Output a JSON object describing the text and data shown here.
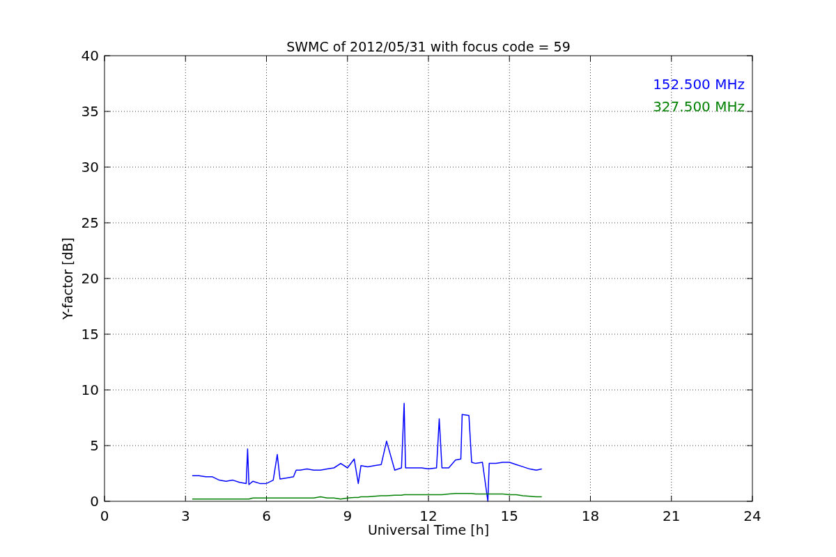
{
  "figure": {
    "chart_data": {
      "type": "line",
      "title": "SWMC of 2012/05/31 with focus code = 59",
      "xlabel": "Universal Time [h]",
      "ylabel": "Y-factor [dB]",
      "xlim": [
        0,
        24
      ],
      "ylim": [
        0,
        40
      ],
      "xticks": [
        0,
        3,
        6,
        9,
        12,
        15,
        18,
        21,
        24
      ],
      "yticks": [
        0,
        5,
        10,
        15,
        20,
        25,
        30,
        35,
        40
      ],
      "grid": true,
      "x": [
        3.25,
        3.5,
        3.75,
        4.0,
        4.25,
        4.5,
        4.75,
        5.0,
        5.25,
        5.3,
        5.35,
        5.5,
        5.75,
        6.0,
        6.25,
        6.4,
        6.5,
        6.75,
        7.0,
        7.1,
        7.25,
        7.5,
        7.75,
        8.0,
        8.25,
        8.5,
        8.75,
        9.0,
        9.25,
        9.4,
        9.5,
        9.75,
        10.0,
        10.25,
        10.45,
        10.75,
        11.0,
        11.1,
        11.15,
        11.5,
        11.75,
        12.0,
        12.3,
        12.4,
        12.5,
        12.75,
        13.0,
        13.2,
        13.25,
        13.5,
        13.6,
        13.75,
        14.0,
        14.2,
        14.25,
        14.5,
        14.75,
        15.0,
        15.25,
        15.5,
        15.75,
        16.0,
        16.2
      ],
      "series": [
        {
          "name": "152.500 MHz",
          "color": "#0000ff",
          "values": [
            2.3,
            2.3,
            2.2,
            2.2,
            1.9,
            1.8,
            1.9,
            1.7,
            1.6,
            4.7,
            1.5,
            1.8,
            1.6,
            1.6,
            1.9,
            4.2,
            2.0,
            2.1,
            2.2,
            2.8,
            2.8,
            2.9,
            2.8,
            2.8,
            2.9,
            3.0,
            3.4,
            3.0,
            3.8,
            1.6,
            3.2,
            3.1,
            3.2,
            3.3,
            5.4,
            2.8,
            3.0,
            8.8,
            3.0,
            3.0,
            3.0,
            2.9,
            3.0,
            7.4,
            3.0,
            3.0,
            3.7,
            3.8,
            7.8,
            7.7,
            3.5,
            3.4,
            3.5,
            0.0,
            3.4,
            3.4,
            3.5,
            3.5,
            3.3,
            3.1,
            2.9,
            2.8,
            2.9
          ]
        },
        {
          "name": "327.500 MHz",
          "color": "#008000",
          "values": [
            0.2,
            0.2,
            0.2,
            0.2,
            0.2,
            0.2,
            0.2,
            0.2,
            0.2,
            0.2,
            0.2,
            0.3,
            0.3,
            0.3,
            0.3,
            0.3,
            0.3,
            0.3,
            0.3,
            0.3,
            0.3,
            0.3,
            0.3,
            0.4,
            0.3,
            0.3,
            0.2,
            0.3,
            0.35,
            0.35,
            0.4,
            0.4,
            0.45,
            0.5,
            0.5,
            0.55,
            0.55,
            0.6,
            0.6,
            0.6,
            0.6,
            0.6,
            0.6,
            0.6,
            0.6,
            0.65,
            0.7,
            0.7,
            0.7,
            0.7,
            0.7,
            0.65,
            0.65,
            0.65,
            0.65,
            0.65,
            0.65,
            0.6,
            0.6,
            0.5,
            0.45,
            0.4,
            0.4
          ]
        }
      ]
    }
  }
}
